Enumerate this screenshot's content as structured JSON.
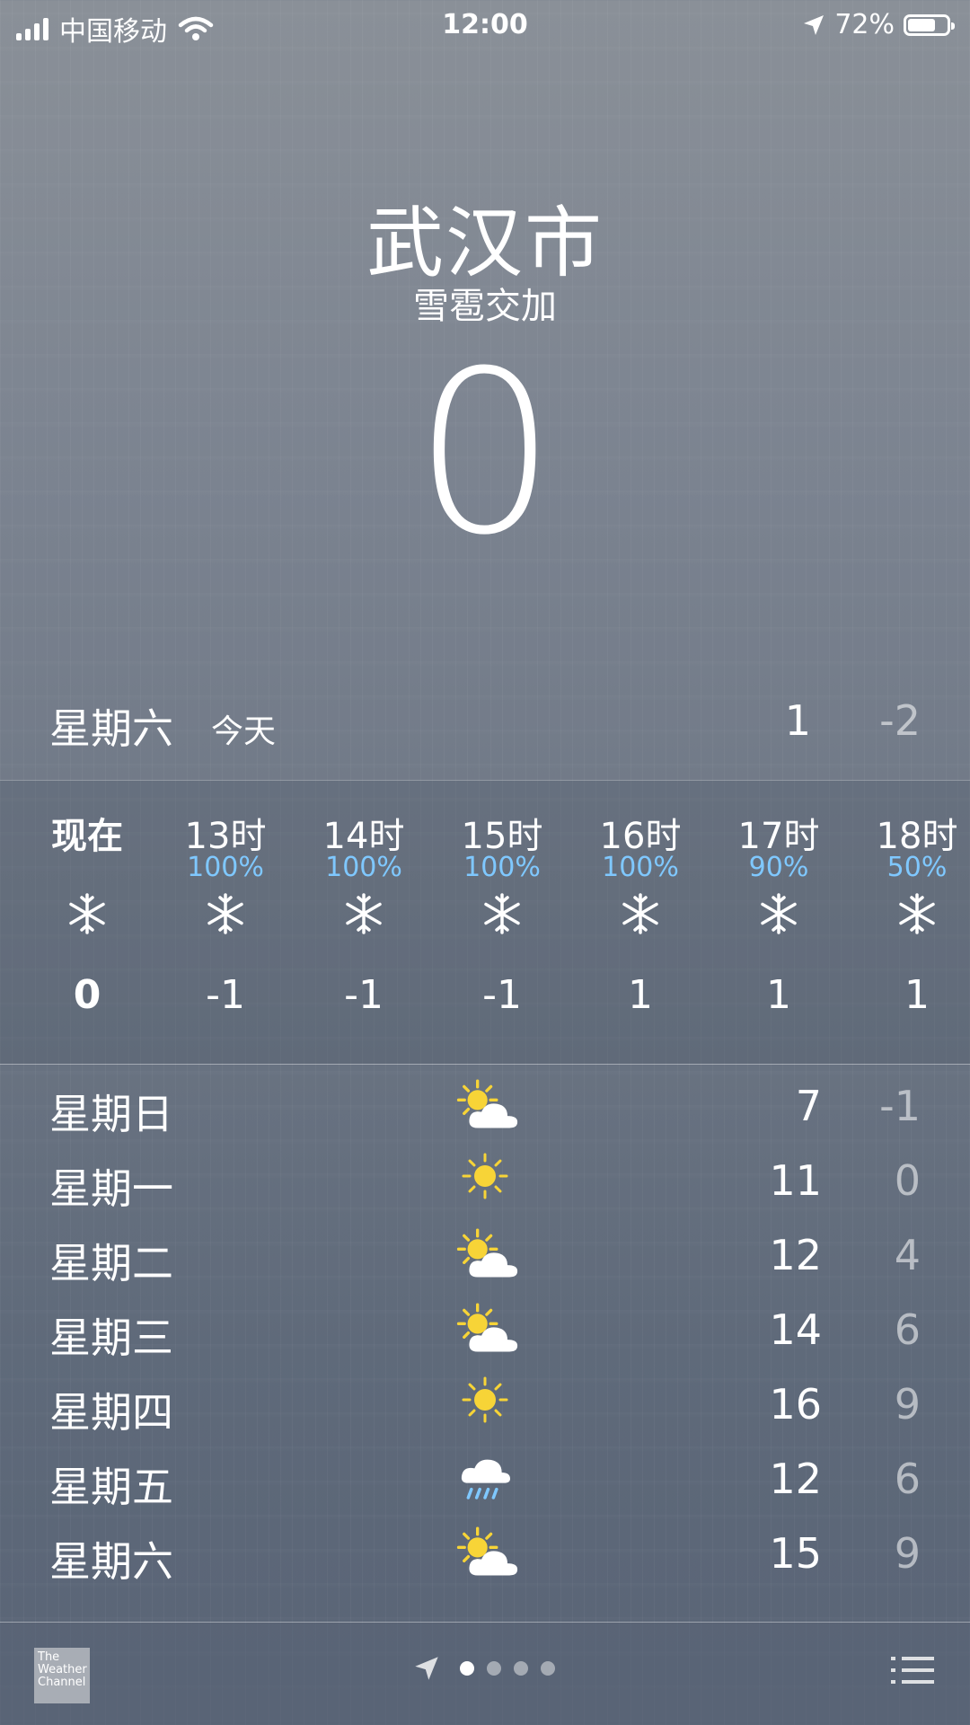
{
  "status_bar": {
    "carrier": "中国移动",
    "time": "12:00",
    "battery_percent": "72%",
    "battery_level": 0.72,
    "icons": [
      "signal-bars-icon",
      "wifi-icon",
      "location-arrow-icon",
      "battery-icon"
    ]
  },
  "header": {
    "city": "武汉市",
    "condition": "雪雹交加",
    "current_temp": "0"
  },
  "today": {
    "day": "星期六",
    "tag": "今天",
    "high": "1",
    "low": "-2"
  },
  "hourly": [
    {
      "label": "现在",
      "precip": "",
      "icon": "snowflake-icon",
      "temp": "0"
    },
    {
      "label": "13时",
      "precip": "100%",
      "icon": "snowflake-icon",
      "temp": "-1"
    },
    {
      "label": "14时",
      "precip": "100%",
      "icon": "snowflake-icon",
      "temp": "-1"
    },
    {
      "label": "15时",
      "precip": "100%",
      "icon": "snowflake-icon",
      "temp": "-1"
    },
    {
      "label": "16时",
      "precip": "100%",
      "icon": "snowflake-icon",
      "temp": "1"
    },
    {
      "label": "17时",
      "precip": "90%",
      "icon": "snowflake-icon",
      "temp": "1"
    },
    {
      "label": "18时",
      "precip": "50%",
      "icon": "snowflake-icon",
      "temp": "1"
    }
  ],
  "daily": [
    {
      "day": "星期日",
      "icon": "partly-cloudy-icon",
      "high": "7",
      "low": "-1"
    },
    {
      "day": "星期一",
      "icon": "sunny-icon",
      "high": "11",
      "low": "0"
    },
    {
      "day": "星期二",
      "icon": "partly-cloudy-icon",
      "high": "12",
      "low": "4"
    },
    {
      "day": "星期三",
      "icon": "partly-cloudy-icon",
      "high": "14",
      "low": "6"
    },
    {
      "day": "星期四",
      "icon": "sunny-icon",
      "high": "16",
      "low": "9"
    },
    {
      "day": "星期五",
      "icon": "rain-cloud-icon",
      "high": "12",
      "low": "6"
    },
    {
      "day": "星期六",
      "icon": "partly-cloudy-icon",
      "high": "15",
      "low": "9"
    }
  ],
  "bottom_bar": {
    "logo_text": "The Weather Channel",
    "page_count": 4,
    "active_page": 0
  },
  "colors": {
    "precip_blue": "#7fc8ff",
    "sun_yellow": "#f7d437",
    "low_temp_gray": "rgba(255,255,255,0.55)"
  }
}
